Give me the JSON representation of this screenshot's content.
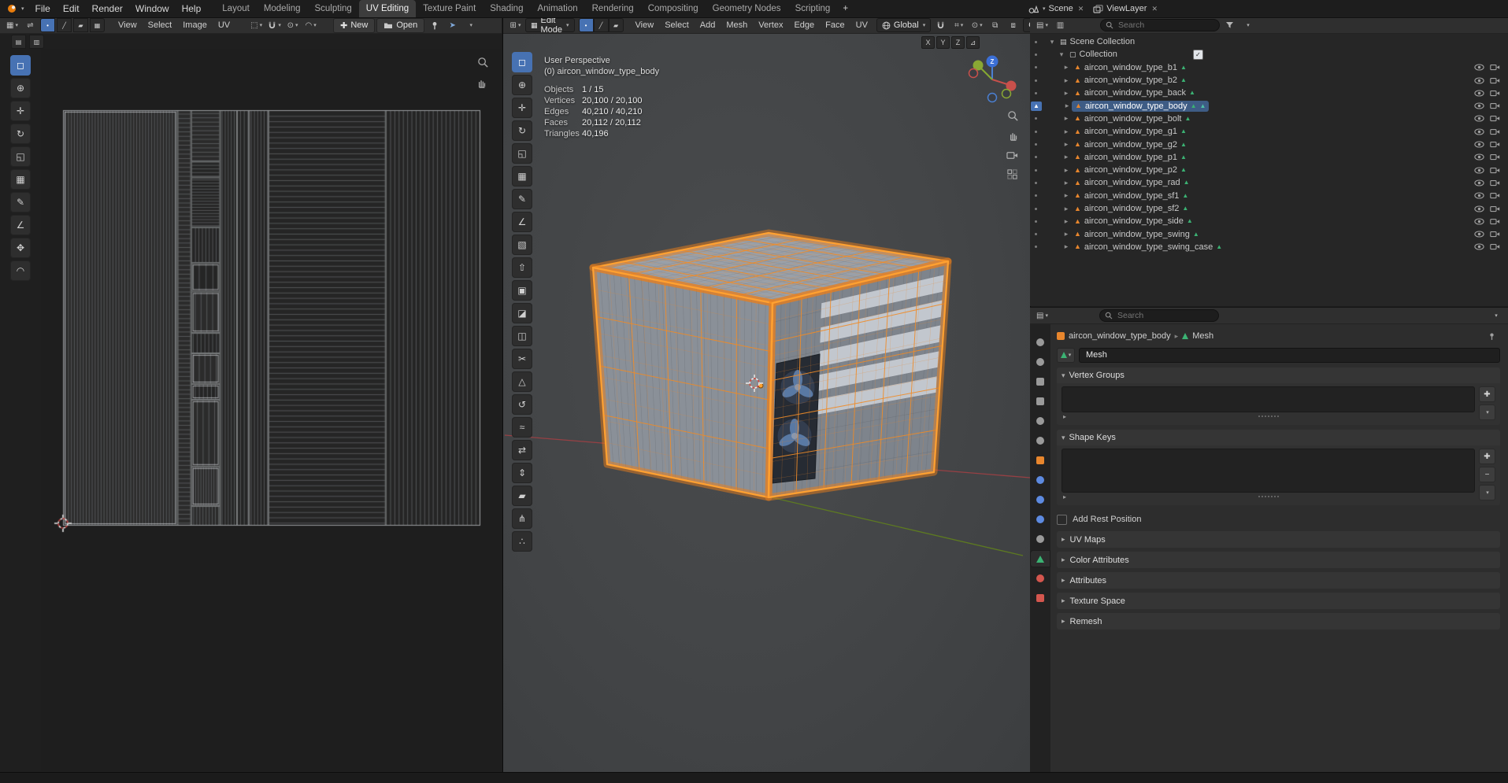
{
  "colors": {
    "accent": "#e8862d",
    "wire": "#ffa132",
    "select": "#4772b3",
    "row_select": "#3e5c85",
    "data_green": "#3bb273",
    "axis_x": "#d24a45",
    "axis_y": "#7ba422",
    "axis_z": "#3b6fd6"
  },
  "topbar": {
    "menus": [
      "File",
      "Edit",
      "Render",
      "Window",
      "Help"
    ],
    "tabs": [
      "Layout",
      "Modeling",
      "Sculpting",
      "UV Editing",
      "Texture Paint",
      "Shading",
      "Animation",
      "Rendering",
      "Compositing",
      "Geometry Nodes",
      "Scripting"
    ],
    "active_tab": "UV Editing",
    "add_tab": "+",
    "scene_label": "Scene",
    "viewlayer_label": "ViewLayer"
  },
  "uv_editor": {
    "menus": [
      "View",
      "Select",
      "Image",
      "UV"
    ],
    "new_label": "New",
    "open_label": "Open",
    "active_tool": "tweak-select-tool",
    "tools": [
      {
        "name": "tweak-select-tool",
        "glyph": "◻"
      },
      {
        "name": "cursor-tool",
        "glyph": "⊕"
      },
      {
        "name": "move-tool",
        "glyph": "✛"
      },
      {
        "name": "rotate-tool",
        "glyph": "↻"
      },
      {
        "name": "scale-tool",
        "glyph": "◱"
      },
      {
        "name": "transform-tool",
        "glyph": "▦"
      },
      {
        "name": "annotate-tool",
        "glyph": "✎"
      },
      {
        "name": "measure-tool",
        "glyph": "∠"
      },
      {
        "name": "grab-tool",
        "glyph": "✥"
      },
      {
        "name": "relax-tool",
        "glyph": "◠"
      }
    ]
  },
  "viewport": {
    "mode_label": "Edit Mode",
    "menus": [
      "View",
      "Select",
      "Add",
      "Mesh",
      "Vertex",
      "Edge",
      "Face",
      "UV"
    ],
    "orientation_label": "Global",
    "options_label": "Options",
    "mirror_toggles": [
      "X",
      "Y",
      "Z"
    ],
    "active_tool": "select-box-tool",
    "tools": [
      {
        "name": "select-box-tool",
        "glyph": "◻"
      },
      {
        "name": "cursor-tool",
        "glyph": "⊕"
      },
      {
        "name": "move-tool",
        "glyph": "✛"
      },
      {
        "name": "rotate-tool",
        "glyph": "↻"
      },
      {
        "name": "scale-tool",
        "glyph": "◱"
      },
      {
        "name": "transform-tool",
        "glyph": "▦"
      },
      {
        "name": "annotate-tool",
        "glyph": "✎"
      },
      {
        "name": "measure-tool",
        "glyph": "∠"
      },
      {
        "name": "add-cube-tool",
        "glyph": "▧"
      },
      {
        "name": "extrude-region-tool",
        "glyph": "⇧"
      },
      {
        "name": "inset-faces-tool",
        "glyph": "▣"
      },
      {
        "name": "bevel-tool",
        "glyph": "◪"
      },
      {
        "name": "loop-cut-tool",
        "glyph": "◫"
      },
      {
        "name": "knife-tool",
        "glyph": "✂"
      },
      {
        "name": "poly-build-tool",
        "glyph": "△"
      },
      {
        "name": "spin-tool",
        "glyph": "↺"
      },
      {
        "name": "smooth-tool",
        "glyph": "≈"
      },
      {
        "name": "edge-slide-tool",
        "glyph": "⇄"
      },
      {
        "name": "shrink-fatten-tool",
        "glyph": "⇕"
      },
      {
        "name": "shear-tool",
        "glyph": "▰"
      },
      {
        "name": "rip-region-tool",
        "glyph": "⋔"
      },
      {
        "name": "randomize-tool",
        "glyph": "∴"
      }
    ],
    "overlay": {
      "view_label": "User Perspective",
      "object_label": "(0) aircon_window_type_body",
      "stats": [
        {
          "label": "Objects",
          "value": "1 / 15"
        },
        {
          "label": "Vertices",
          "value": "20,100 / 20,100"
        },
        {
          "label": "Edges",
          "value": "40,210 / 40,210"
        },
        {
          "label": "Faces",
          "value": "20,112 / 20,112"
        },
        {
          "label": "Triangles",
          "value": "40,196"
        }
      ]
    },
    "gizmo_z_label": "Z"
  },
  "outliner": {
    "search_placeholder": "Search",
    "root_label": "Scene Collection",
    "collection_label": "Collection",
    "active_object": "aircon_window_type_body",
    "objects": [
      "aircon_window_type_b1",
      "aircon_window_type_b2",
      "aircon_window_type_back",
      "aircon_window_type_body",
      "aircon_window_type_bolt",
      "aircon_window_type_g1",
      "aircon_window_type_g2",
      "aircon_window_type_p1",
      "aircon_window_type_p2",
      "aircon_window_type_rad",
      "aircon_window_type_sf1",
      "aircon_window_type_sf2",
      "aircon_window_type_side",
      "aircon_window_type_swing",
      "aircon_window_type_swing_case"
    ]
  },
  "properties": {
    "search_placeholder": "Search",
    "breadcrumb_object": "aircon_window_type_body",
    "breadcrumb_data": "Mesh",
    "datablock_name": "Mesh",
    "panel_vertex_groups": "Vertex Groups",
    "panel_shape_keys": "Shape Keys",
    "add_rest_position": "Add Rest Position",
    "collapsed_panels": [
      "UV Maps",
      "Color Attributes",
      "Attributes",
      "Texture Space",
      "Remesh"
    ],
    "active_tab": "object-data",
    "tabs": [
      {
        "name": "tool",
        "shape": "circle",
        "color": "#9a9a9a"
      },
      {
        "name": "render",
        "shape": "circle",
        "color": "#9a9a9a"
      },
      {
        "name": "output",
        "shape": "square",
        "color": "#9a9a9a"
      },
      {
        "name": "view-layer",
        "shape": "square",
        "color": "#9a9a9a"
      },
      {
        "name": "scene",
        "shape": "circle",
        "color": "#9a9a9a"
      },
      {
        "name": "world",
        "shape": "circle",
        "color": "#9a9a9a"
      },
      {
        "name": "object",
        "shape": "square",
        "color": "#e8862d"
      },
      {
        "name": "modifiers",
        "shape": "circle",
        "color": "#5d8ae0"
      },
      {
        "name": "particles",
        "shape": "circle",
        "color": "#5d8ae0"
      },
      {
        "name": "physics",
        "shape": "circle",
        "color": "#5d8ae0"
      },
      {
        "name": "constraints",
        "shape": "circle",
        "color": "#9a9a9a"
      },
      {
        "name": "object-data",
        "shape": "triangle",
        "color": "#3bb273"
      },
      {
        "name": "material",
        "shape": "circle",
        "color": "#d4564e"
      },
      {
        "name": "texture",
        "shape": "square",
        "color": "#d4564e"
      }
    ]
  }
}
